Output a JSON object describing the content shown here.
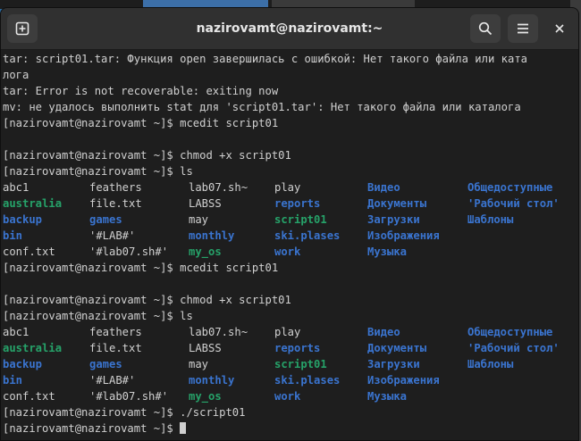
{
  "window": {
    "title": "nazirovamt@nazirovamt:~"
  },
  "icons": {
    "new_tab": "new-tab-icon",
    "search": "search-icon",
    "menu": "hamburger-menu-icon",
    "close": "close-icon"
  },
  "colors": {
    "directory": "#3a74cf",
    "executable": "#26a269",
    "text": "#d0d0d0",
    "background": "#1e1e1e"
  },
  "terminal": {
    "lines": [
      "tar: script01.tar: Функция open завершилась с ошибкой: Нет такого файла или ката",
      "лога",
      "tar: Error is not recoverable: exiting now",
      "mv: не удалось выполнить stat для 'script01.tar': Нет такого файла или каталога",
      "[nazirovamt@nazirovamt ~]$ mcedit script01",
      "",
      "[nazirovamt@nazirovamt ~]$ chmod +x script01",
      "[nazirovamt@nazirovamt ~]$ ls"
    ],
    "ls1": [
      [
        [
          "abc1",
          "n"
        ],
        [
          "feathers",
          "n"
        ],
        [
          "lab07.sh~",
          "n"
        ],
        [
          "play",
          "n"
        ],
        [
          "Видео",
          "d"
        ],
        [
          "Общедоступные",
          "d"
        ]
      ],
      [
        [
          "australia",
          "x"
        ],
        [
          "file.txt",
          "n"
        ],
        [
          "LABSS",
          "n"
        ],
        [
          "reports",
          "d"
        ],
        [
          "Документы",
          "d"
        ],
        [
          "'Рабочий стол'",
          "d"
        ]
      ],
      [
        [
          "backup",
          "d"
        ],
        [
          "games",
          "d"
        ],
        [
          "may",
          "n"
        ],
        [
          "script01",
          "x"
        ],
        [
          "Загрузки",
          "d"
        ],
        [
          "Шаблоны",
          "d"
        ]
      ],
      [
        [
          "bin",
          "d"
        ],
        [
          "'#LAB#'",
          "n"
        ],
        [
          "monthly",
          "d"
        ],
        [
          "ski.plases",
          "d"
        ],
        [
          "Изображения",
          "d"
        ],
        [
          "",
          ""
        ]
      ],
      [
        [
          "conf.txt",
          "n"
        ],
        [
          "'#lab07.sh#'",
          "n"
        ],
        [
          "my_os",
          "x"
        ],
        [
          "work",
          "d"
        ],
        [
          "Музыка",
          "d"
        ],
        [
          "",
          ""
        ]
      ]
    ],
    "lines2": [
      "[nazirovamt@nazirovamt ~]$ mcedit script01",
      "",
      "[nazirovamt@nazirovamt ~]$ chmod +x script01",
      "[nazirovamt@nazirovamt ~]$ ls"
    ],
    "ls2": [
      [
        [
          "abc1",
          "n"
        ],
        [
          "feathers",
          "n"
        ],
        [
          "lab07.sh~",
          "n"
        ],
        [
          "play",
          "n"
        ],
        [
          "Видео",
          "d"
        ],
        [
          "Общедоступные",
          "d"
        ]
      ],
      [
        [
          "australia",
          "x"
        ],
        [
          "file.txt",
          "n"
        ],
        [
          "LABSS",
          "n"
        ],
        [
          "reports",
          "d"
        ],
        [
          "Документы",
          "d"
        ],
        [
          "'Рабочий стол'",
          "d"
        ]
      ],
      [
        [
          "backup",
          "d"
        ],
        [
          "games",
          "d"
        ],
        [
          "may",
          "n"
        ],
        [
          "script01",
          "x"
        ],
        [
          "Загрузки",
          "d"
        ],
        [
          "Шаблоны",
          "d"
        ]
      ],
      [
        [
          "bin",
          "d"
        ],
        [
          "'#LAB#'",
          "n"
        ],
        [
          "monthly",
          "d"
        ],
        [
          "ski.plases",
          "d"
        ],
        [
          "Изображения",
          "d"
        ],
        [
          "",
          ""
        ]
      ],
      [
        [
          "conf.txt",
          "n"
        ],
        [
          "'#lab07.sh#'",
          "n"
        ],
        [
          "my_os",
          "x"
        ],
        [
          "work",
          "d"
        ],
        [
          "Музыка",
          "d"
        ],
        [
          "",
          ""
        ]
      ]
    ],
    "lines3": [
      "[nazirovamt@nazirovamt ~]$ ./script01"
    ],
    "prompt": "[nazirovamt@nazirovamt ~]$ "
  }
}
